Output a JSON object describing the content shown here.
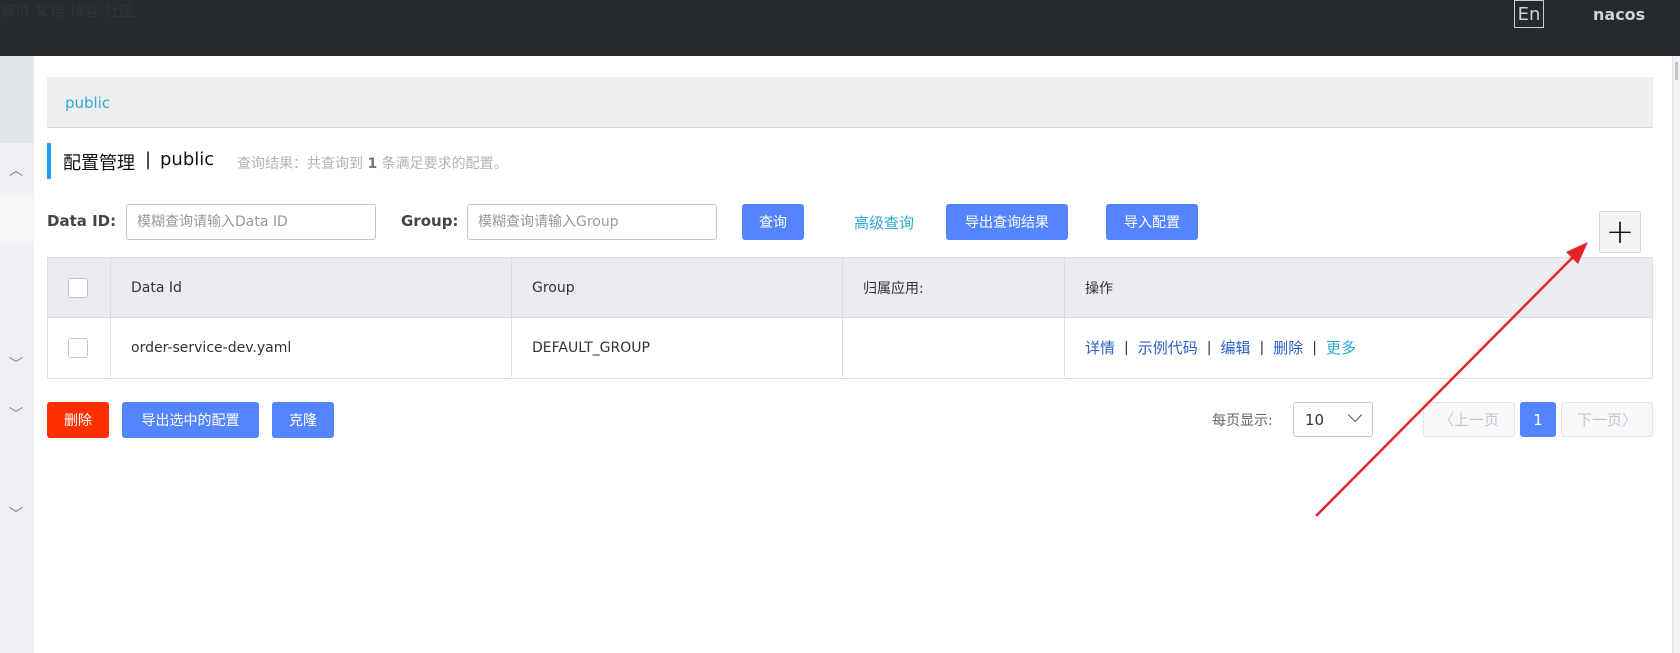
{
  "topbar": {
    "nav": [
      "首页",
      "文档",
      "博客",
      "社区"
    ],
    "lang": "En",
    "user": "nacos"
  },
  "namespace_strip": {
    "active": "public"
  },
  "title": {
    "main": "配置管理",
    "separator": "|",
    "namespace": "public",
    "summary_prefix": "查询结果：共查询到",
    "summary_count": "1",
    "summary_suffix": "条满足要求的配置。"
  },
  "filters": {
    "dataid_label": "Data ID:",
    "dataid_placeholder": "模糊查询请输入Data ID",
    "group_label": "Group:",
    "group_placeholder": "模糊查询请输入Group",
    "query_btn": "查询",
    "advanced_link": "高级查询",
    "export_btn": "导出查询结果",
    "import_btn": "导入配置",
    "add_btn": "+"
  },
  "table": {
    "columns": [
      "Data Id",
      "Group",
      "归属应用:",
      "操作"
    ],
    "rows": [
      {
        "data_id": "order-service-dev.yaml",
        "group": "DEFAULT_GROUP",
        "app": ""
      }
    ],
    "ops": [
      "详情",
      "示例代码",
      "编辑",
      "删除",
      "更多"
    ]
  },
  "bulk": {
    "delete_btn": "删除",
    "export_selected_btn": "导出选中的配置",
    "clone_btn": "克隆"
  },
  "pagination": {
    "page_size_label": "每页显示:",
    "page_size": "10",
    "prev": "上一页",
    "current": "1",
    "next": "下一页"
  },
  "colors": {
    "topbar": "#252a2f",
    "primary": "#5584ff",
    "danger": "#ff3000",
    "link": "#2aa9d6",
    "annotation": "#e8222b"
  }
}
